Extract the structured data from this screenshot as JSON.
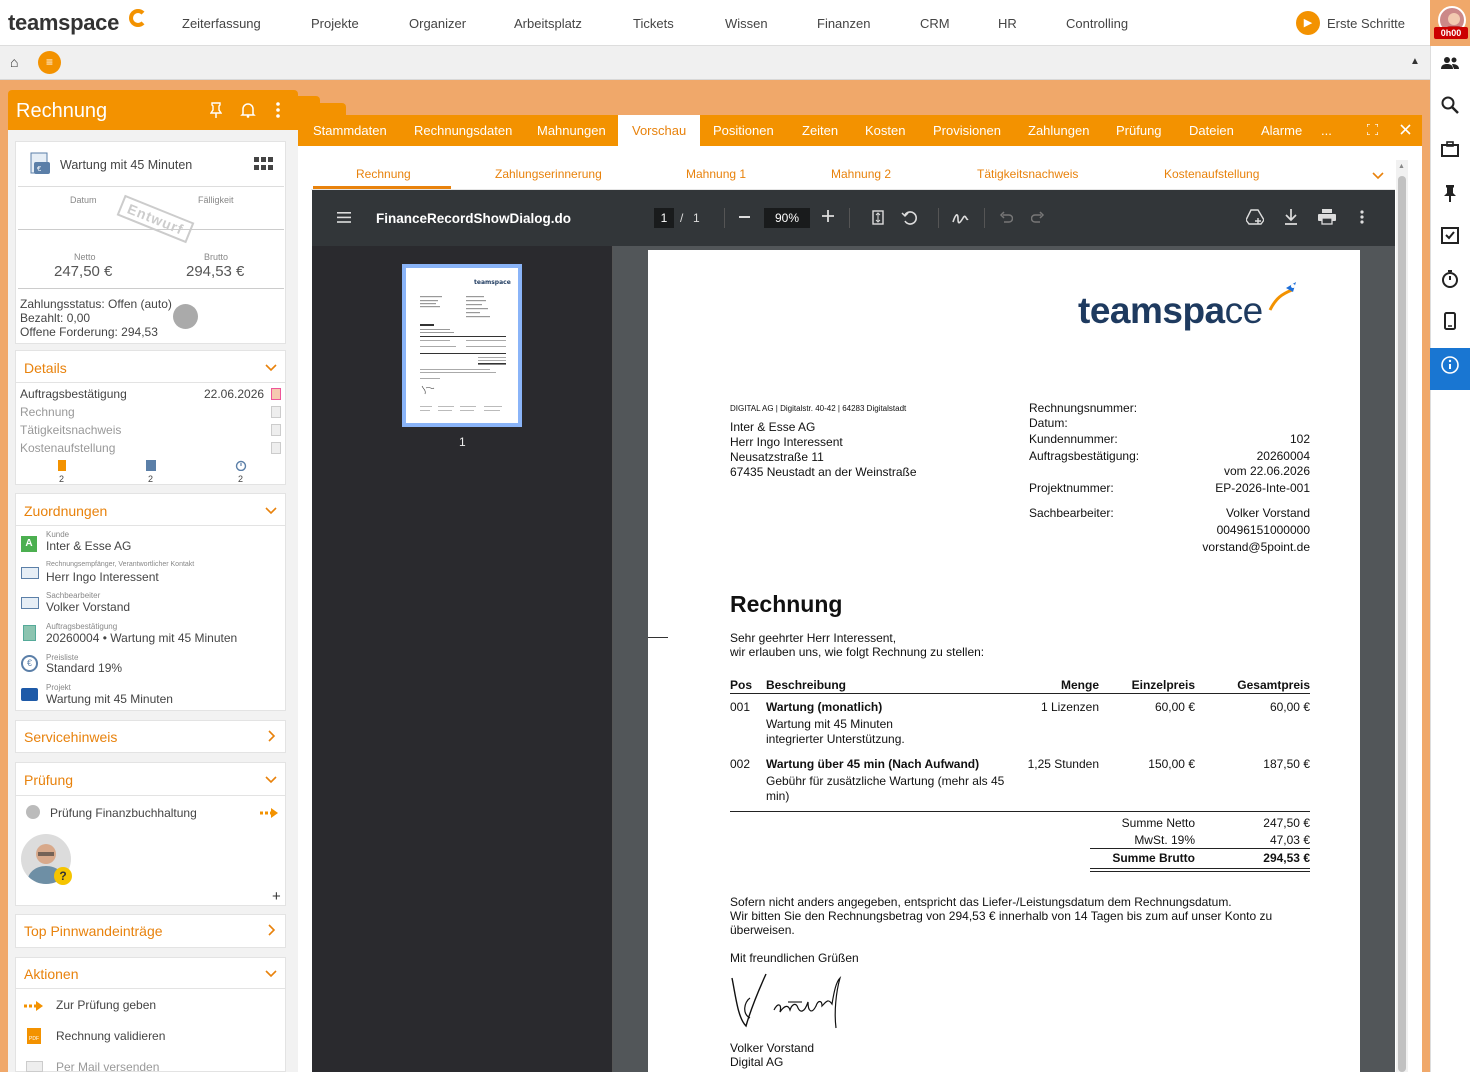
{
  "app": {
    "brand": "teamspace",
    "nav": [
      "Zeiterfassung",
      "Projekte",
      "Organizer",
      "Arbeitsplatz",
      "Tickets",
      "Wissen",
      "Finanzen",
      "CRM",
      "HR",
      "Controlling"
    ],
    "erste_schritte": "Erste Schritte",
    "timer": "0h00",
    "home_icon": "⌂",
    "menu_icon": "≡",
    "collapse_icon": "▲"
  },
  "right_sidebar": [
    "people-icon",
    "search-icon",
    "briefcase-icon",
    "pin-icon",
    "checklist-icon",
    "stopwatch-icon",
    "phone-icon",
    "info-icon"
  ],
  "left_panel": {
    "title": "Rechnung",
    "doc": {
      "title": "Wartung mit 45 Minuten",
      "datum_label": "Datum",
      "faelligkeit_label": "Fälligkeit",
      "stamp": "Entwurf",
      "netto_label": "Netto",
      "netto": "247,50 €",
      "brutto_label": "Brutto",
      "brutto": "294,53 €",
      "zahlungsstatus": "Zahlungsstatus: Offen (auto)",
      "bezahlt": "Bezahlt: 0,00",
      "forderung": "Offene Forderung: 294,53"
    },
    "details": {
      "title": "Details",
      "rows": [
        {
          "label": "Auftragsbestätigung",
          "date": "22.06.2026"
        },
        {
          "label": "Rechnung",
          "date": ""
        },
        {
          "label": "Tätigkeitsnachweis",
          "date": ""
        },
        {
          "label": "Kostenaufstellung",
          "date": ""
        }
      ],
      "counts": [
        "2",
        "2",
        "2"
      ]
    },
    "zuordnungen": {
      "title": "Zuordnungen",
      "items": [
        {
          "small": "Kunde",
          "value": "Inter & Esse AG"
        },
        {
          "small": "Rechnungsempfänger, Verantwortlicher Kontakt",
          "value": "Herr Ingo Interessent"
        },
        {
          "small": "Sachbearbeiter",
          "value": "Volker Vorstand"
        },
        {
          "small": "Auftragsbestätigung",
          "value": "20260004 • Wartung mit 45 Minuten"
        },
        {
          "small": "Preisliste",
          "value": "Standard 19%"
        },
        {
          "small": "Projekt",
          "value": "Wartung mit 45 Minuten"
        }
      ]
    },
    "servicehinweis": "Servicehinweis",
    "pruefung": {
      "title": "Prüfung",
      "item": "Prüfung Finanzbuchhaltung",
      "plus": "+"
    },
    "pinnwand": "Top Pinnwandeinträge",
    "aktionen": {
      "title": "Aktionen",
      "items": [
        "Zur Prüfung geben",
        "Rechnung validieren",
        "Per Mail versenden"
      ]
    }
  },
  "main": {
    "tabs": [
      "Stammdaten",
      "Rechnungsdaten",
      "Mahnungen",
      "Vorschau",
      "Positionen",
      "Zeiten",
      "Kosten",
      "Provisionen",
      "Zahlungen",
      "Prüfung",
      "Dateien",
      "Alarme",
      "..."
    ],
    "active_tab": "Vorschau",
    "subtabs": [
      "Rechnung",
      "Zahlungserinnerung",
      "Mahnung 1",
      "Mahnung 2",
      "Tätigkeitsnachweis",
      "Kostenaufstellung"
    ],
    "pdf": {
      "filename": "FinanceRecordShowDialog.do",
      "page": "1",
      "page_sep": "/",
      "pages": "1",
      "zoom": "90%",
      "thumb_label": "1"
    }
  },
  "invoice": {
    "logo_a": "teamspa",
    "logo_b": "ce",
    "sender_line": "DIGITAL AG | Digitalstr. 40-42 | 64283 Digitalstadt",
    "recipient": [
      "Inter & Esse AG",
      "Herr Ingo Interessent",
      "Neusatzstraße 11",
      "67435 Neustadt an der Weinstraße"
    ],
    "meta_labels": [
      "Rechnungsnummer:",
      "Datum:",
      "Kundennummer:",
      "Auftragsbestätigung:",
      "Projektnummer:",
      "Sachbearbeiter:"
    ],
    "kundennummer": "102",
    "auftrag": "20260004",
    "auftrag_vom": "vom 22.06.2026",
    "projektnummer": "EP-2026-Inte-001",
    "sachbearbeiter": "Volker Vorstand",
    "telefon": "00496151000000",
    "email": "vorstand@5point.de",
    "heading": "Rechnung",
    "greeting": "Sehr geehrter Herr Interessent,",
    "intro": "wir erlauben uns, wie folgt Rechnung zu stellen:",
    "cols": [
      "Pos",
      "Beschreibung",
      "Menge",
      "Einzelpreis",
      "Gesamtpreis"
    ],
    "rows": [
      {
        "pos": "001",
        "title": "Wartung (monatlich)",
        "desc1": "Wartung mit 45 Minuten",
        "desc2": "integrierter Unterstützung.",
        "menge": "1 Lizenzen",
        "einzel": "60,00 €",
        "gesamt": "60,00 €"
      },
      {
        "pos": "002",
        "title": "Wartung über 45 min (Nach Aufwand)",
        "desc1": "Gebühr für zusätzliche Wartung (mehr als 45",
        "desc2": "min)",
        "menge": "1,25 Stunden",
        "einzel": "150,00 €",
        "gesamt": "187,50 €"
      }
    ],
    "summe_netto_label": "Summe Netto",
    "summe_netto": "247,50 €",
    "mwst_label": "MwSt. 19%",
    "mwst": "47,03 €",
    "summe_brutto_label": "Summe Brutto",
    "summe_brutto": "294,53 €",
    "footer1": "Sofern nicht anders angegeben, entspricht das Liefer-/Leistungsdatum dem Rechnungsdatum.",
    "footer2": "Wir bitten Sie den Rechnungsbetrag von 294,53 € innerhalb von 14 Tagen bis zum auf unser Konto zu",
    "footer3": "überweisen.",
    "closing": "Mit freundlichen Grüßen",
    "signer": "Volker Vorstand",
    "company": "Digital AG"
  }
}
